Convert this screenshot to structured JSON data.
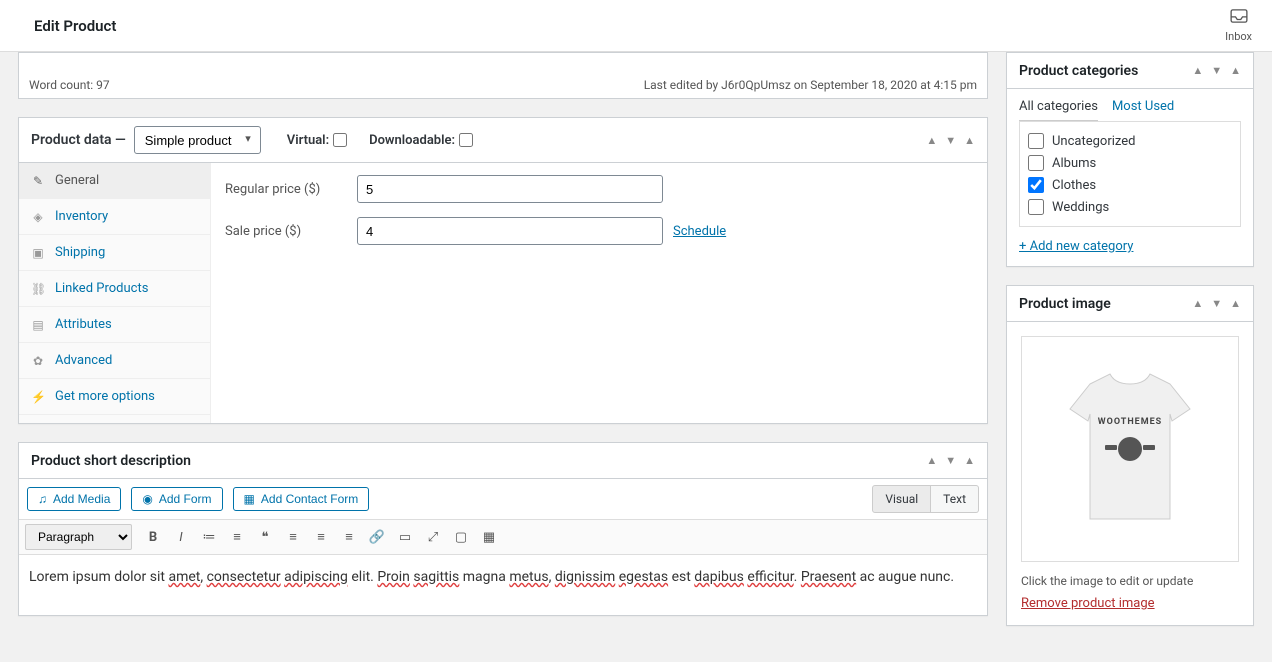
{
  "header": {
    "title": "Edit Product",
    "inbox": "Inbox"
  },
  "wordbar": {
    "word_count": "Word count: 97",
    "last_edited": "Last edited by J6r0QpUmsz on September 18, 2020 at 4:15 pm"
  },
  "product_data": {
    "label": "Product data —",
    "type": "Simple product",
    "virtual_label": "Virtual:",
    "downloadable_label": "Downloadable:",
    "tabs": {
      "general": "General",
      "inventory": "Inventory",
      "shipping": "Shipping",
      "linked": "Linked Products",
      "attributes": "Attributes",
      "advanced": "Advanced",
      "more": "Get more options"
    },
    "regular_label": "Regular price ($)",
    "regular_value": "5",
    "sale_label": "Sale price ($)",
    "sale_value": "4",
    "schedule": "Schedule"
  },
  "short_desc": {
    "title": "Product short description",
    "add_media": "Add Media",
    "add_form": "Add Form",
    "add_contact_form": "Add Contact Form",
    "visual": "Visual",
    "text": "Text",
    "paragraph": "Paragraph",
    "content_parts": {
      "p1": "Lorem ipsum dolor sit ",
      "w1": "amet",
      "p2": ", ",
      "w2": "consectetur",
      "p3": " ",
      "w3": "adipiscing",
      "p4": " elit. ",
      "w4": "Proin",
      "p5": " ",
      "w5": "sagittis",
      "p6": " magna ",
      "w6": "metus",
      "p7": ", ",
      "w7": "dignissim",
      "p8": " ",
      "w8": "egestas",
      "p9": " est ",
      "w9": "dapibus",
      "p10": " ",
      "w10": "efficitur",
      "p11": ". ",
      "w11": "Praesent",
      "p12": " ac augue nunc."
    }
  },
  "categories": {
    "title": "Product categories",
    "tab_all": "All categories",
    "tab_most": "Most Used",
    "items": {
      "uncategorized": "Uncategorized",
      "albums": "Albums",
      "clothes": "Clothes",
      "weddings": "Weddings"
    },
    "add_new": "+ Add new category"
  },
  "product_image": {
    "title": "Product image",
    "help": "Click the image to edit or update",
    "remove": "Remove product image"
  }
}
